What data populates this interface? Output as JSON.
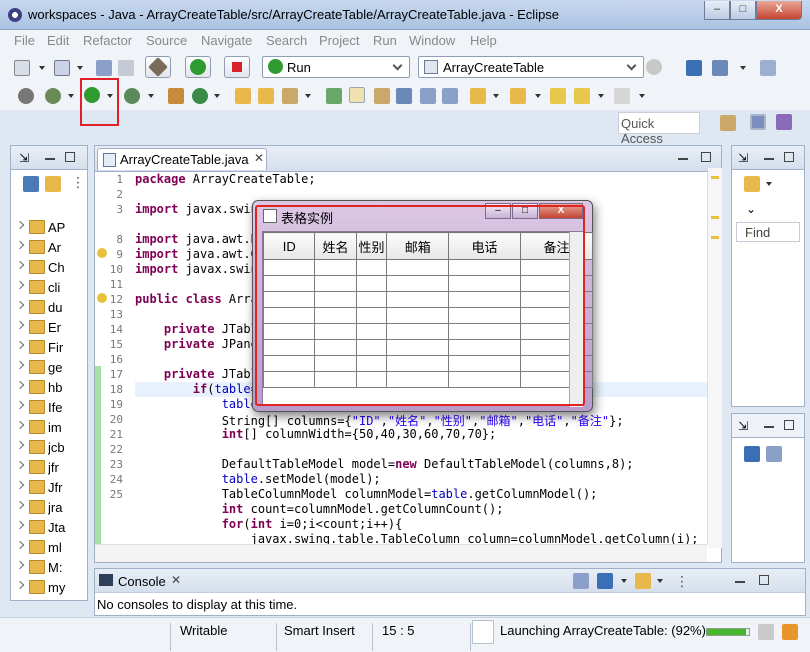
{
  "window": {
    "title": "workspaces - Java - ArrayCreateTable/src/ArrayCreateTable/ArrayCreateTable.java - Eclipse",
    "minimize": "–",
    "maximize": "□",
    "close": "X"
  },
  "menu": [
    "File",
    "Edit",
    "Refactor",
    "Source",
    "Navigate",
    "Search",
    "Project",
    "Run",
    "Window",
    "Help"
  ],
  "toolbar": {
    "run_config_label": "Run",
    "launch_target_label": "ArrayCreateTable",
    "quick_access_label": "Quick Access"
  },
  "package_explorer": {
    "items": [
      "AP",
      "Ar",
      "Ch",
      "cli",
      "du",
      "Er",
      "Fir",
      "ge",
      "hb",
      "Ife",
      "im",
      "jcb",
      "jfr",
      "Jfr",
      "jra",
      "Jta",
      "ml",
      "M:",
      "my"
    ]
  },
  "editor": {
    "tab_label": "ArrayCreateTable.java",
    "line_numbers": [
      "1",
      "2",
      "3",
      "8",
      "9",
      "10",
      "11",
      "12",
      "13",
      "14",
      "15",
      "16",
      "17",
      "18",
      "19",
      "20",
      "21",
      "22",
      "23",
      "24",
      "25"
    ]
  },
  "outline": {
    "find_label": "Find"
  },
  "dialog": {
    "title": "表格实例",
    "columns": [
      "ID",
      "姓名",
      "性别",
      "邮箱",
      "电话",
      "备注"
    ]
  },
  "console": {
    "tab_label": "Console",
    "message": "No consoles to display at this time."
  },
  "status": {
    "mode": "Writable",
    "insert": "Smart Insert",
    "position": "15 : 5",
    "launch_progress_text": "Launching ArrayCreateTable: (92%)",
    "launch_progress": 0.92
  },
  "colors": {
    "highlight_box": "#e0202a",
    "keyword": "#7f0055",
    "field": "#0000c0",
    "string": "#2a00ff",
    "progress": "#47b52d"
  }
}
